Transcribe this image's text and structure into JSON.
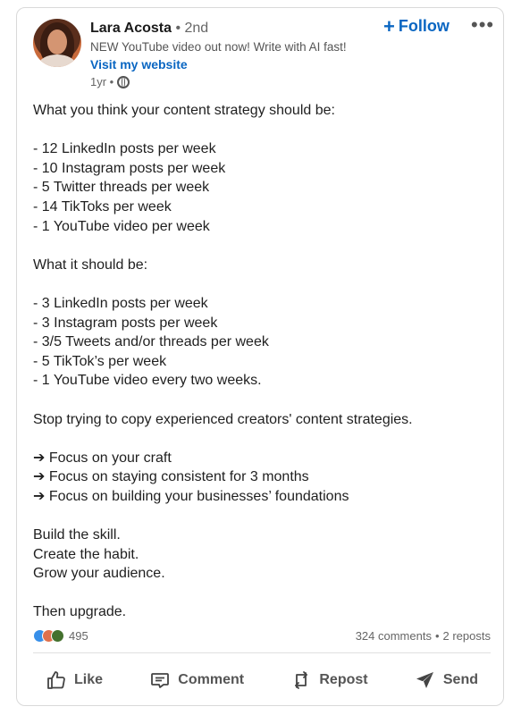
{
  "author": {
    "name": "Lara Acosta",
    "degree": "• 2nd",
    "headline": "NEW YouTube video out now! Write with AI fast!",
    "website_label": "Visit my website",
    "time": "1yr •"
  },
  "follow_label": "Follow",
  "more_label": "•••",
  "post_lines": [
    "What you think your content strategy should be:",
    "",
    "- 12 LinkedIn posts per week",
    "- 10 Instagram posts per week",
    "- 5 Twitter threads per week",
    "- 14 TikToks per week",
    "- 1 YouTube video per week",
    "",
    "What it should be:",
    "",
    "- 3 LinkedIn posts per week",
    "- 3 Instagram posts per week",
    "- 3/5 Tweets and/or threads per week",
    "- 5 TikTok’s per week",
    "- 1 YouTube video every two weeks.",
    "",
    "Stop trying to copy experienced creators' content strategies.",
    "",
    "➔ Focus on your craft",
    "➔ Focus on staying consistent for 3 months",
    "➔ Focus on building your businesses’ foundations",
    "",
    "Build the skill.",
    "Create the habit.",
    "Grow your audience.",
    "",
    "Then upgrade."
  ],
  "stats": {
    "reaction_count": "495",
    "comments": "324 comments",
    "separator": "•",
    "reposts": "2 reposts"
  },
  "actions": {
    "like": "Like",
    "comment": "Comment",
    "repost": "Repost",
    "send": "Send"
  },
  "colors": {
    "accent": "#0a66c2",
    "like_reaction": "#378fe9",
    "love_reaction": "#df704d",
    "insight_reaction": "#44712e"
  }
}
